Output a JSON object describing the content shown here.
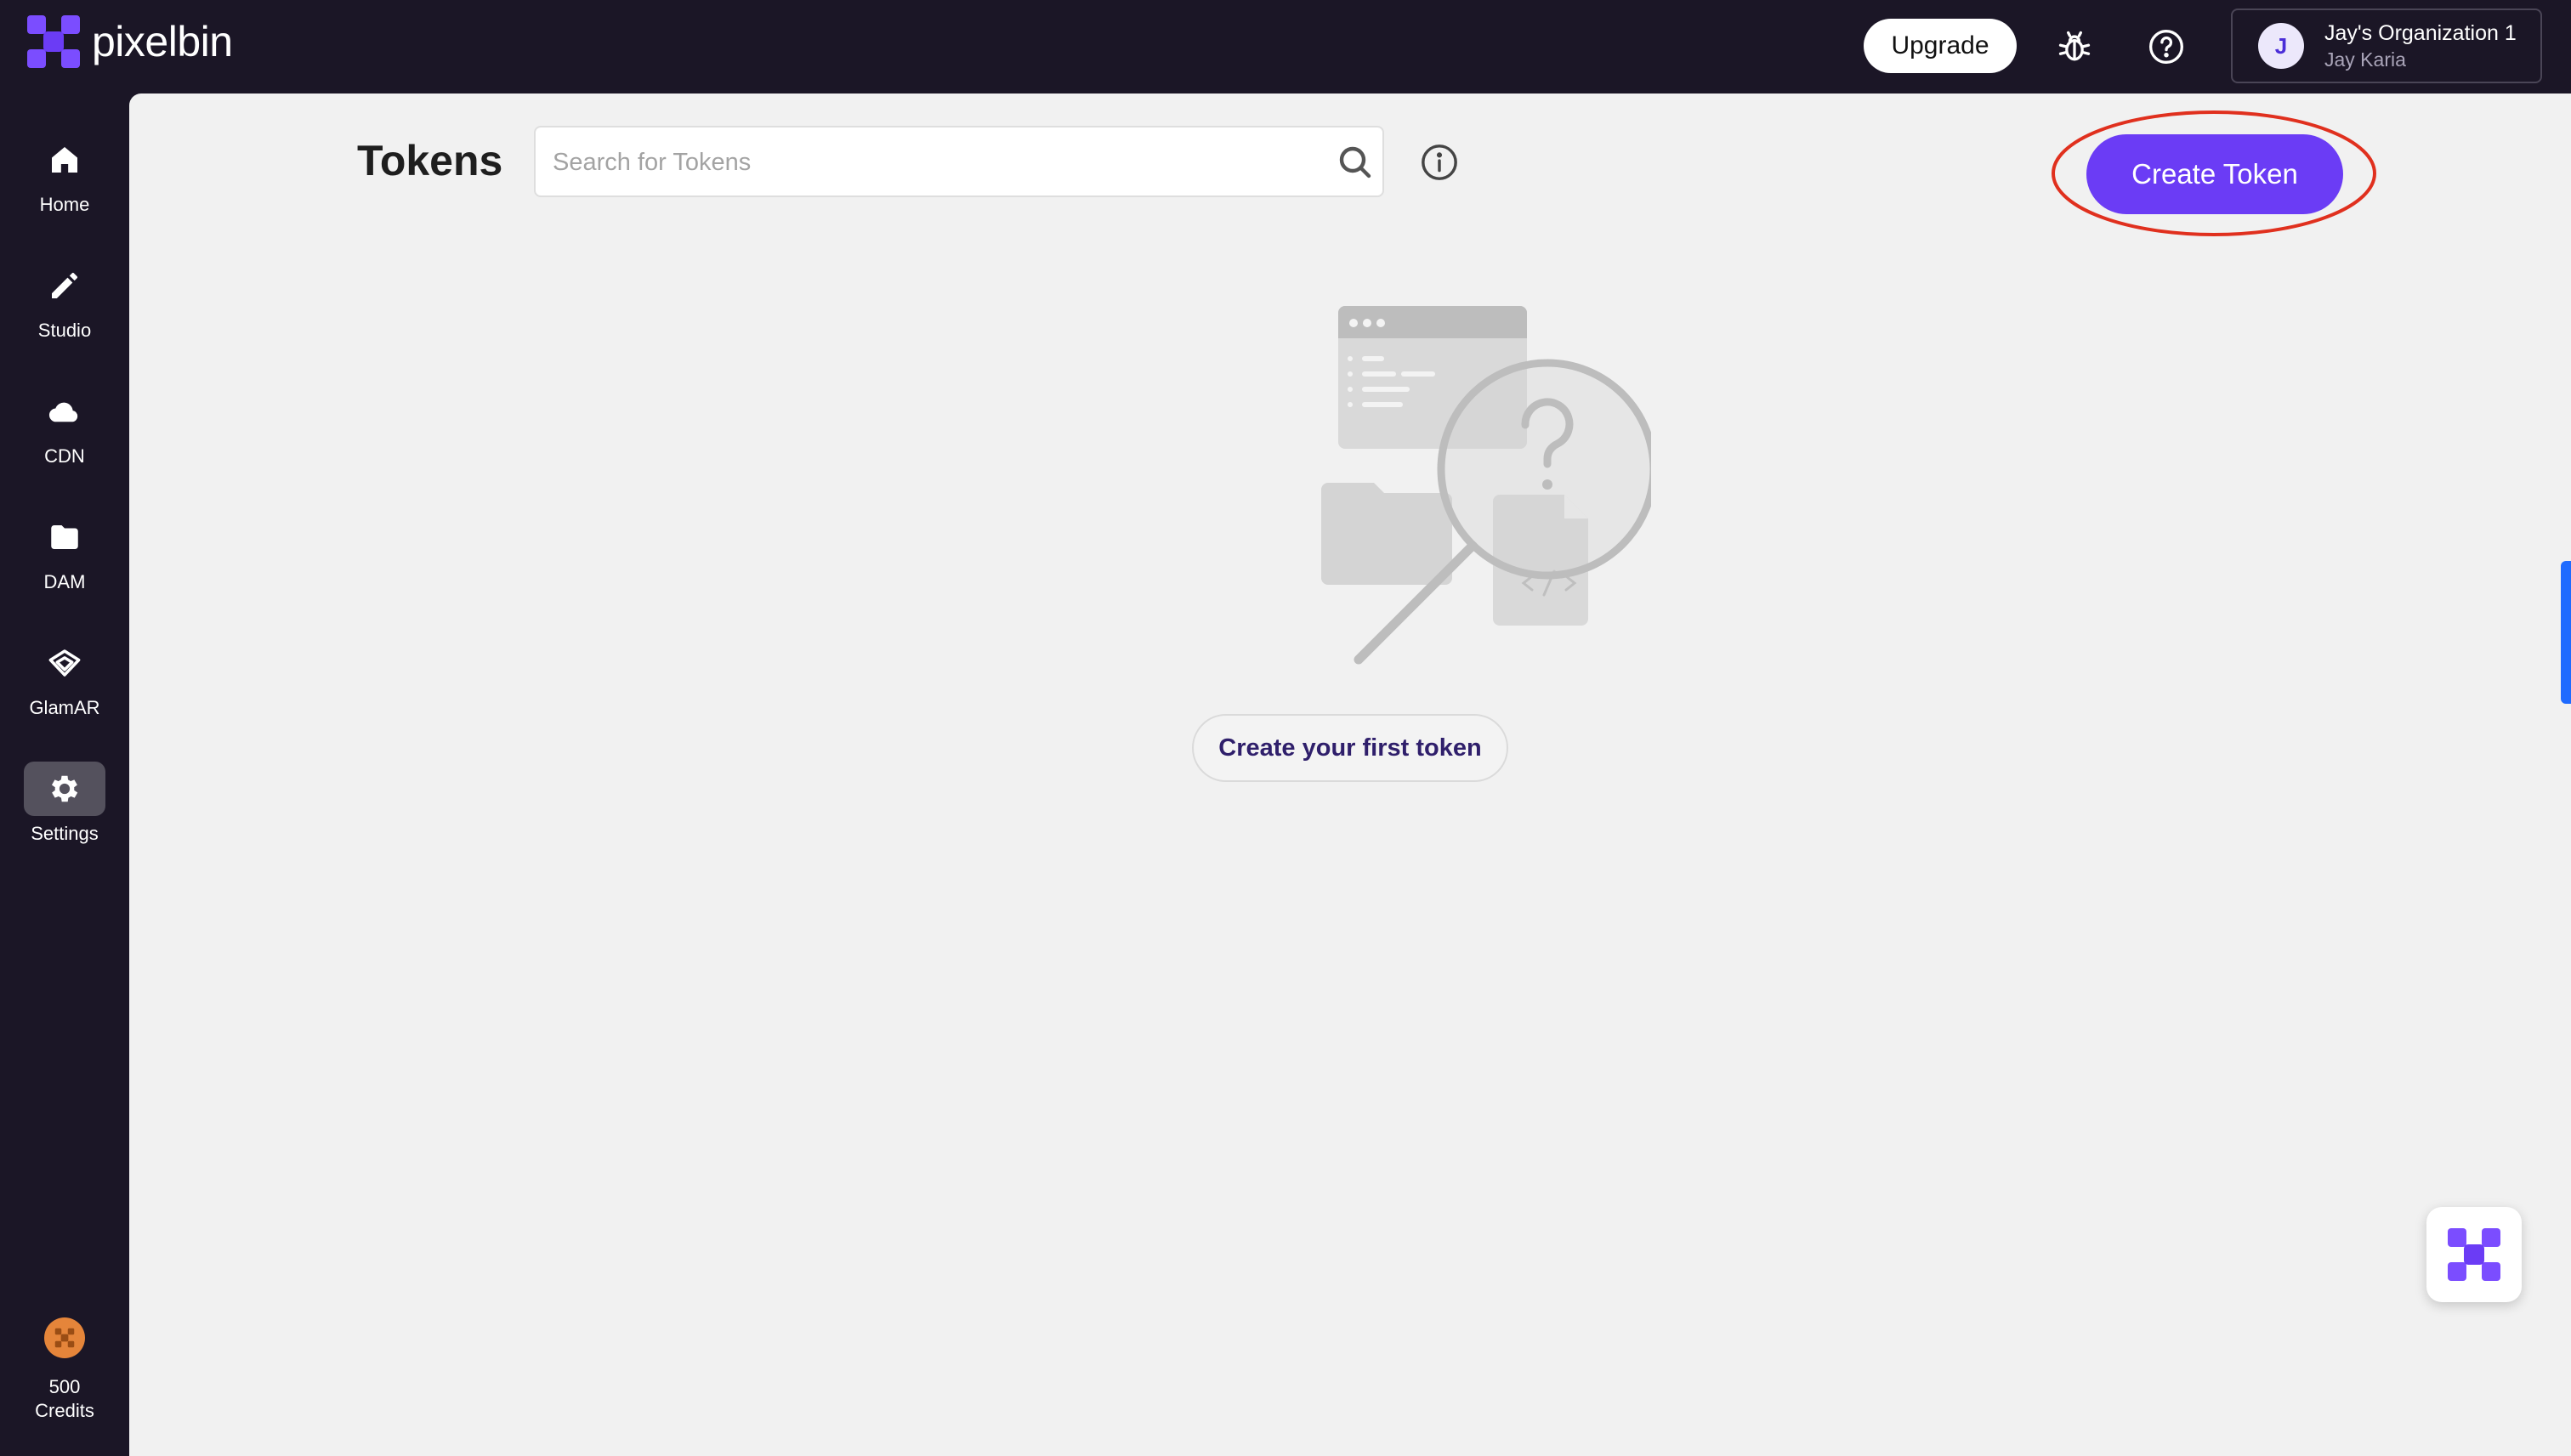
{
  "app": {
    "name": "pixelbin"
  },
  "header": {
    "upgrade_label": "Upgrade",
    "org_initial": "J",
    "org_name": "Jay's Organization 1",
    "user_name": "Jay Karia"
  },
  "sidebar": {
    "items": [
      {
        "label": "Home",
        "icon": "home-icon",
        "active": false
      },
      {
        "label": "Studio",
        "icon": "pencil-icon",
        "active": false
      },
      {
        "label": "CDN",
        "icon": "cloud-icon",
        "active": false
      },
      {
        "label": "DAM",
        "icon": "folder-icon",
        "active": false
      },
      {
        "label": "GlamAR",
        "icon": "glamar-icon",
        "active": false
      },
      {
        "label": "Settings",
        "icon": "gear-icon",
        "active": true
      }
    ],
    "credits_amount": "500",
    "credits_label": "Credits"
  },
  "main": {
    "title": "Tokens",
    "search_placeholder": "Search for Tokens",
    "create_token_label": "Create Token",
    "empty_state_button": "Create your first token"
  },
  "colors": {
    "brand_purple": "#6b3cf5",
    "dark_bg": "#1b1626",
    "main_bg": "#f1f1f1",
    "highlight_ring": "#e0301e",
    "credits_orange": "#e5853a",
    "side_tab_blue": "#1f6bff"
  }
}
